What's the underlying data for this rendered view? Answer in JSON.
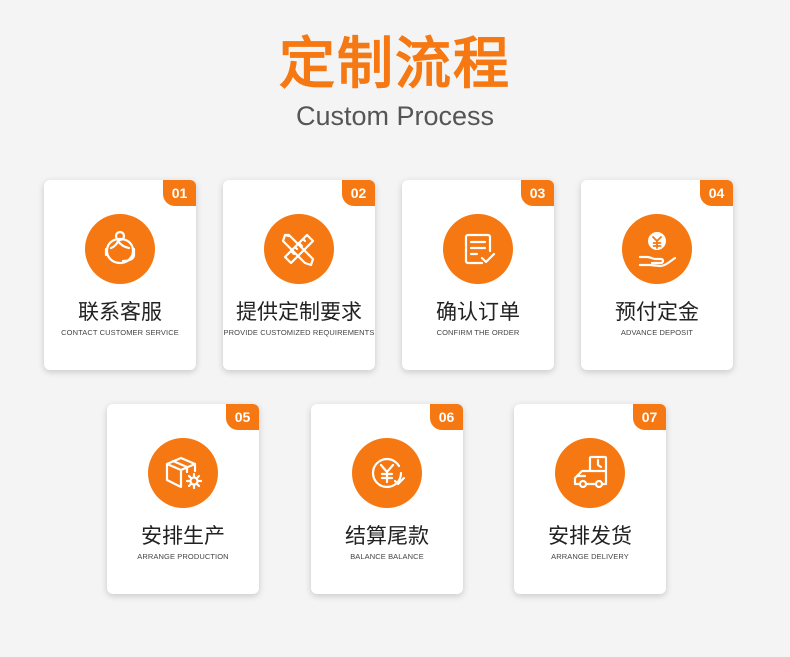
{
  "header": {
    "title": "定制流程",
    "subtitle": "Custom Process"
  },
  "accent_color": "#f57812",
  "steps": [
    {
      "num": "01",
      "title": "联系客服",
      "subtitle": "CONTACT CUSTOMER SERVICE",
      "icon": "customer-service-icon"
    },
    {
      "num": "02",
      "title": "提供定制要求",
      "subtitle": "PROVIDE CUSTOMIZED REQUIREMENTS",
      "icon": "pencil-ruler-icon"
    },
    {
      "num": "03",
      "title": "确认订单",
      "subtitle": "CONFIRM THE ORDER",
      "icon": "order-check-icon"
    },
    {
      "num": "04",
      "title": "预付定金",
      "subtitle": "ADVANCE DEPOSIT",
      "icon": "deposit-icon"
    },
    {
      "num": "05",
      "title": "安排生产",
      "subtitle": "ARRANGE PRODUCTION",
      "icon": "box-gear-icon"
    },
    {
      "num": "06",
      "title": "结算尾款",
      "subtitle": "BALANCE BALANCE",
      "icon": "yuan-check-icon"
    },
    {
      "num": "07",
      "title": "安排发货",
      "subtitle": "ARRANGE DELIVERY",
      "icon": "delivery-truck-icon"
    }
  ]
}
